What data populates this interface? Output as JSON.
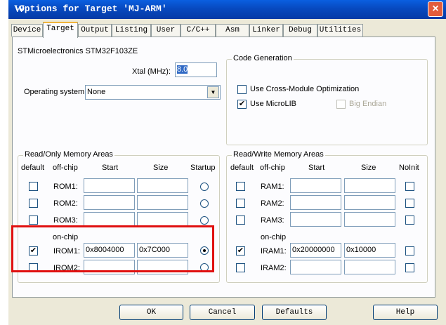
{
  "window": {
    "title": "Options for Target 'MJ-ARM'",
    "icon_glyph": "W",
    "close_glyph": "×"
  },
  "tabs": [
    "Device",
    "Target",
    "Output",
    "Listing",
    "User",
    "C/C++",
    "Asm",
    "Linker",
    "Debug",
    "Utilities"
  ],
  "active_tab": "Target",
  "device_name": "STMicroelectronics STM32F103ZE",
  "xtal": {
    "label": "Xtal (MHz):",
    "value": "8.0"
  },
  "os": {
    "label": "Operating system:",
    "value": "None",
    "arrow": "▼"
  },
  "code_generation": {
    "title": "Code Generation",
    "cross_module": {
      "label": "Use Cross-Module Optimization",
      "checked": false
    },
    "microlib": {
      "label": "Use MicroLIB",
      "checked": true
    },
    "big_endian": {
      "label": "Big Endian",
      "checked": false,
      "enabled": false
    }
  },
  "ro_memory": {
    "title": "Read/Only Memory Areas",
    "headers": {
      "default": "default",
      "offchip": "off-chip",
      "start": "Start",
      "size": "Size",
      "startup": "Startup"
    },
    "offchip_rows": [
      {
        "name": "ROM1:",
        "default": false,
        "start": "",
        "size": "",
        "startup": false
      },
      {
        "name": "ROM2:",
        "default": false,
        "start": "",
        "size": "",
        "startup": false
      },
      {
        "name": "ROM3:",
        "default": false,
        "start": "",
        "size": "",
        "startup": false
      }
    ],
    "onchip_label": "on-chip",
    "onchip_rows": [
      {
        "name": "IROM1:",
        "default": true,
        "start": "0x8004000",
        "size": "0x7C000",
        "startup": true
      },
      {
        "name": "IROM2:",
        "default": false,
        "start": "",
        "size": "",
        "startup": false
      }
    ]
  },
  "rw_memory": {
    "title": "Read/Write Memory Areas",
    "headers": {
      "default": "default",
      "offchip": "off-chip",
      "start": "Start",
      "size": "Size",
      "noinit": "NoInit"
    },
    "offchip_rows": [
      {
        "name": "RAM1:",
        "default": false,
        "start": "",
        "size": "",
        "noinit": false
      },
      {
        "name": "RAM2:",
        "default": false,
        "start": "",
        "size": "",
        "noinit": false
      },
      {
        "name": "RAM3:",
        "default": false,
        "start": "",
        "size": "",
        "noinit": false
      }
    ],
    "onchip_label": "on-chip",
    "onchip_rows": [
      {
        "name": "IRAM1:",
        "default": true,
        "start": "0x20000000",
        "size": "0x10000",
        "noinit": false
      },
      {
        "name": "IRAM2:",
        "default": false,
        "start": "",
        "size": "",
        "noinit": false
      }
    ]
  },
  "buttons": {
    "ok": "OK",
    "cancel": "Cancel",
    "defaults": "Defaults",
    "help": "Help"
  },
  "colors": {
    "titlebar": "#0749bf",
    "dialog_bg": "#ece9d8",
    "highlight_box": "#e01010"
  }
}
